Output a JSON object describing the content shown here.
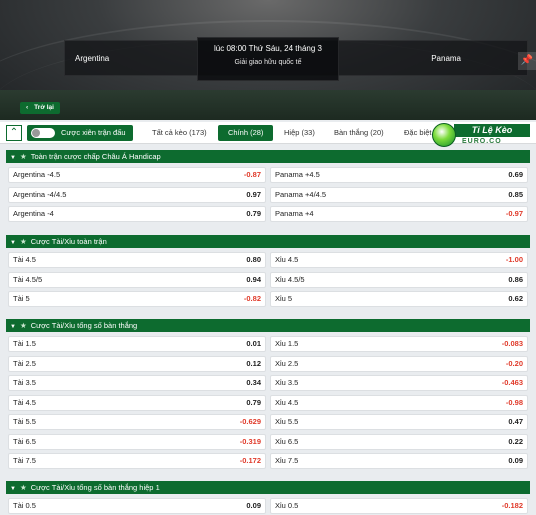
{
  "match": {
    "home_team": "Argentina",
    "away_team": "Panama",
    "kickoff": "lúc 08:00 Thứ Sáu, 24 tháng 3",
    "league": "Giải giao hữu quốc tế",
    "back_label": "Trở lại"
  },
  "filters": {
    "combo_label": "Cược xiên trận đấu",
    "tabs": [
      {
        "label": "Tất cả kèo (173)"
      },
      {
        "label": "Chính (28)"
      },
      {
        "label": "Hiệp (33)"
      },
      {
        "label": "Bàn thắng (20)"
      },
      {
        "label": "Đặc biệt"
      }
    ]
  },
  "logo": {
    "word": "Tỉ Lệ Kèo",
    "sub": "EURO.CO"
  },
  "sections": [
    {
      "title": "Toàn trận cược chấp Châu Á Handicap",
      "rows": [
        [
          {
            "name": "Argentina -4.5",
            "odd": "-0.87"
          },
          {
            "name": "Panama +4.5",
            "odd": "0.69"
          }
        ],
        [
          {
            "name": "Argentina -4/4.5",
            "odd": "0.97"
          },
          {
            "name": "Panama +4/4.5",
            "odd": "0.85"
          }
        ],
        [
          {
            "name": "Argentina -4",
            "odd": "0.79"
          },
          {
            "name": "Panama +4",
            "odd": "-0.97"
          }
        ]
      ]
    },
    {
      "title": "Cược Tài/Xỉu toàn trận",
      "rows": [
        [
          {
            "name": "Tài 4.5",
            "odd": "0.80"
          },
          {
            "name": "Xỉu 4.5",
            "odd": "-1.00"
          }
        ],
        [
          {
            "name": "Tài 4.5/5",
            "odd": "0.94"
          },
          {
            "name": "Xỉu 4.5/5",
            "odd": "0.86"
          }
        ],
        [
          {
            "name": "Tài 5",
            "odd": "-0.82"
          },
          {
            "name": "Xỉu 5",
            "odd": "0.62"
          }
        ]
      ]
    },
    {
      "title": "Cược Tài/Xỉu tổng số bàn thắng",
      "rows": [
        [
          {
            "name": "Tài 1.5",
            "odd": "0.01"
          },
          {
            "name": "Xỉu 1.5",
            "odd": "-0.083"
          }
        ],
        [
          {
            "name": "Tài 2.5",
            "odd": "0.12"
          },
          {
            "name": "Xỉu 2.5",
            "odd": "-0.20"
          }
        ],
        [
          {
            "name": "Tài 3.5",
            "odd": "0.34"
          },
          {
            "name": "Xỉu 3.5",
            "odd": "-0.463"
          }
        ],
        [
          {
            "name": "Tài 4.5",
            "odd": "0.79"
          },
          {
            "name": "Xỉu 4.5",
            "odd": "-0.98"
          }
        ],
        [
          {
            "name": "Tài 5.5",
            "odd": "-0.629"
          },
          {
            "name": "Xỉu 5.5",
            "odd": "0.47"
          }
        ],
        [
          {
            "name": "Tài 6.5",
            "odd": "-0.319"
          },
          {
            "name": "Xỉu 6.5",
            "odd": "0.22"
          }
        ],
        [
          {
            "name": "Tài 7.5",
            "odd": "-0.172"
          },
          {
            "name": "Xỉu 7.5",
            "odd": "0.09"
          }
        ]
      ]
    },
    {
      "title": "Cược Tài/Xỉu tổng số bàn thắng hiệp 1",
      "rows": [
        [
          {
            "name": "Tài 0.5",
            "odd": "0.09"
          },
          {
            "name": "Xỉu 0.5",
            "odd": "-0.182"
          }
        ]
      ]
    }
  ],
  "colors": {
    "brand_green": "#0d6b2f",
    "negative": "#e03b2b"
  }
}
